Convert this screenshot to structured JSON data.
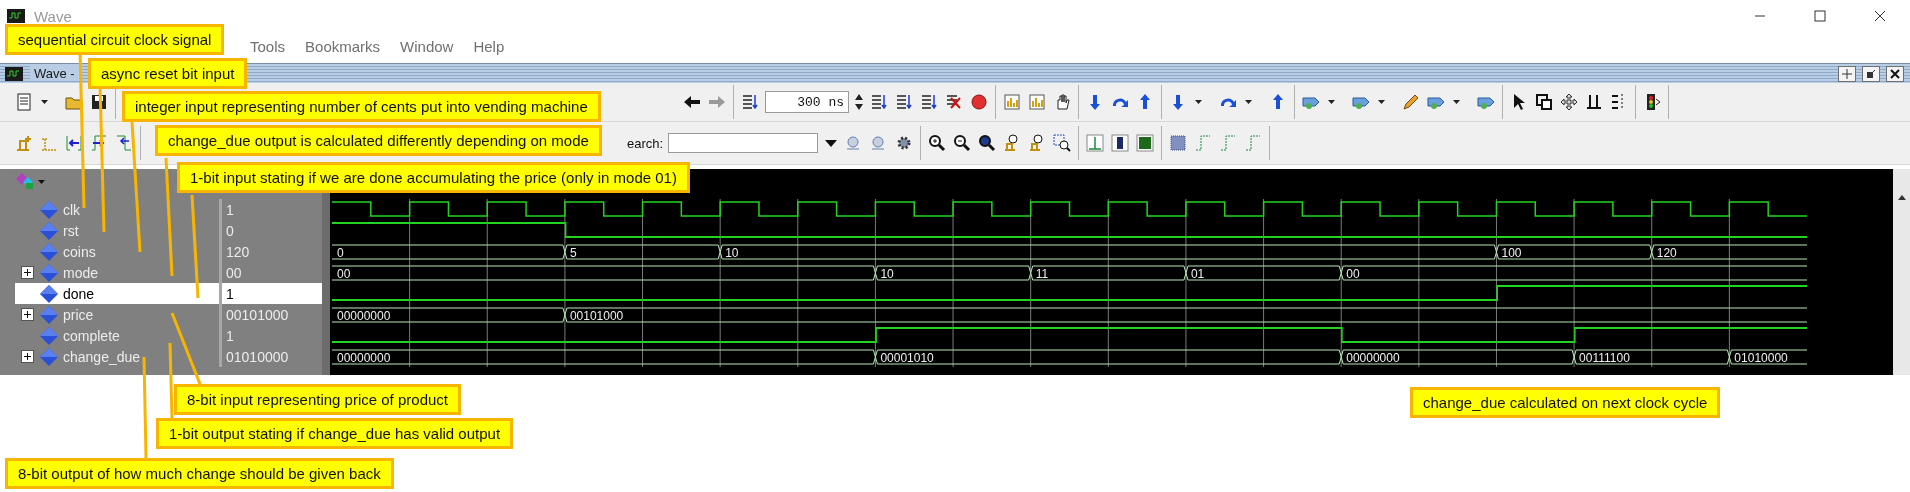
{
  "window": {
    "title": "Wave"
  },
  "menu": [
    {
      "label": "Tools"
    },
    {
      "label": "Bookmarks"
    },
    {
      "label": "Window"
    },
    {
      "label": "Help"
    }
  ],
  "subwindow": {
    "title": "Wave -"
  },
  "toolbar": {
    "time_field": {
      "value": "300 ns"
    },
    "search": {
      "label": "earch:"
    }
  },
  "signals": [
    {
      "name": "clk",
      "value": "1",
      "expandable": false,
      "selected": false,
      "kind": "clock"
    },
    {
      "name": "rst",
      "value": "0",
      "expandable": false,
      "selected": false,
      "kind": "bit",
      "high": [
        true,
        true,
        true,
        false,
        false,
        false,
        false,
        false,
        false,
        false,
        false,
        false,
        false,
        false,
        false,
        false,
        false,
        false,
        false
      ]
    },
    {
      "name": "coins",
      "value": "120",
      "expandable": false,
      "selected": false,
      "kind": "bus",
      "change": [
        true,
        false,
        false,
        true,
        false,
        true,
        false,
        false,
        false,
        false,
        false,
        false,
        false,
        false,
        false,
        true,
        false,
        true,
        false
      ],
      "data": [
        "0",
        "5",
        "10",
        "100",
        "120"
      ]
    },
    {
      "name": "mode",
      "value": "00",
      "expandable": true,
      "selected": false,
      "kind": "bus",
      "change": [
        true,
        false,
        false,
        false,
        false,
        false,
        false,
        true,
        false,
        true,
        false,
        true,
        false,
        true,
        false,
        false,
        false,
        false,
        false
      ],
      "data": [
        "00",
        "10",
        "11",
        "01",
        "00"
      ]
    },
    {
      "name": "done",
      "value": "1",
      "expandable": false,
      "selected": true,
      "kind": "bit",
      "high": [
        false,
        false,
        false,
        false,
        false,
        false,
        false,
        false,
        false,
        false,
        false,
        false,
        false,
        false,
        false,
        true,
        true,
        true,
        true
      ]
    },
    {
      "name": "price",
      "value": "00101000",
      "expandable": true,
      "selected": false,
      "kind": "bus",
      "change": [
        true,
        false,
        false,
        true,
        false,
        false,
        false,
        false,
        false,
        false,
        false,
        false,
        false,
        false,
        false,
        false,
        false,
        false,
        false
      ],
      "data": [
        "00000000",
        "00101000"
      ]
    },
    {
      "name": "complete",
      "value": "1",
      "expandable": false,
      "selected": false,
      "kind": "bit",
      "high": [
        false,
        false,
        false,
        false,
        false,
        false,
        false,
        true,
        true,
        true,
        true,
        true,
        true,
        false,
        false,
        false,
        true,
        true,
        true
      ]
    },
    {
      "name": "change_due",
      "value": "01010000",
      "expandable": true,
      "selected": false,
      "kind": "bus",
      "change": [
        true,
        false,
        false,
        false,
        false,
        false,
        false,
        true,
        false,
        false,
        false,
        false,
        false,
        true,
        false,
        false,
        true,
        false,
        true
      ],
      "data": [
        "00000000",
        "00001010",
        "00000000",
        "00111100",
        "01010000"
      ]
    }
  ],
  "annotations": [
    {
      "text": "sequential circuit clock signal"
    },
    {
      "text": "async reset bit input"
    },
    {
      "text": "integer input representing number of cents put into vending machine"
    },
    {
      "text": "change_due output is calculated differently depending on mode"
    },
    {
      "text": "1-bit input stating if we are done accumulating the price (only in mode 01)"
    },
    {
      "text": "8-bit input representing price of product"
    },
    {
      "text": "1-bit output stating if change_due has valid output"
    },
    {
      "text": "8-bit output of how much change should be given back"
    },
    {
      "text": "change_due calculated on next clock cycle"
    }
  ]
}
